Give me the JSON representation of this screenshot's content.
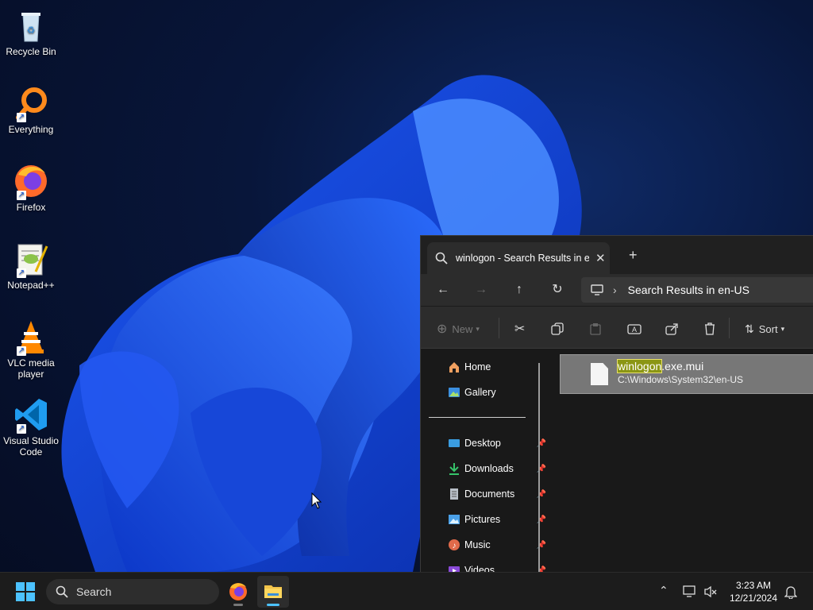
{
  "desktop": {
    "icons": [
      {
        "label": "Recycle Bin",
        "icon": "recycle-bin-icon"
      },
      {
        "label": "Everything",
        "icon": "everything-search-icon"
      },
      {
        "label": "Firefox",
        "icon": "firefox-icon"
      },
      {
        "label": "Notepad++",
        "icon": "notepadpp-icon"
      },
      {
        "label": "VLC media player",
        "icon": "vlc-icon"
      },
      {
        "label": "Visual Studio Code",
        "icon": "vscode-icon"
      }
    ]
  },
  "explorer": {
    "tab": {
      "title": "winlogon - Search Results in e",
      "icon": "search-icon"
    },
    "address": {
      "breadcrumb": "Search Results in en-US",
      "icon": "computer-icon"
    },
    "toolbar": {
      "new_label": "New",
      "sort_label": "Sort"
    },
    "nav": {
      "top": [
        {
          "label": "Home",
          "icon": "home-icon"
        },
        {
          "label": "Gallery",
          "icon": "gallery-icon"
        }
      ],
      "quick": [
        {
          "label": "Desktop",
          "icon": "desktop-folder-icon",
          "pinned": true
        },
        {
          "label": "Downloads",
          "icon": "downloads-icon",
          "pinned": true
        },
        {
          "label": "Documents",
          "icon": "documents-icon",
          "pinned": true
        },
        {
          "label": "Pictures",
          "icon": "pictures-icon",
          "pinned": true
        },
        {
          "label": "Music",
          "icon": "music-icon",
          "pinned": true
        },
        {
          "label": "Videos",
          "icon": "videos-icon",
          "pinned": true
        }
      ]
    },
    "results": [
      {
        "name_highlight": "winlogon",
        "name_rest": ".exe.mui",
        "path": "C:\\Windows\\System32\\en-US"
      }
    ]
  },
  "taskbar": {
    "search_placeholder": "Search",
    "clock": {
      "time": "3:23 AM",
      "date": "12/21/2024"
    },
    "accent": "#4cc2ff"
  }
}
